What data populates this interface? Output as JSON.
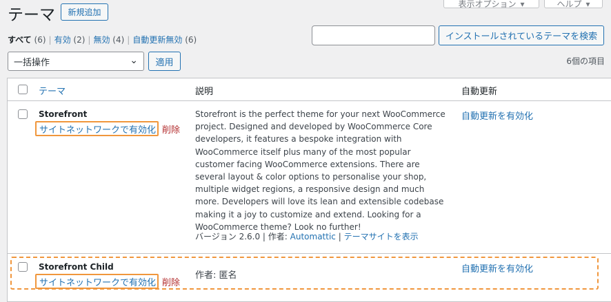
{
  "page": {
    "title": "テーマ",
    "add_new_label": "新規追加",
    "screen_options_label": "表示オプション",
    "help_label": "ヘルプ"
  },
  "views": [
    {
      "label": "すべて",
      "count": "(6)",
      "current": true
    },
    {
      "label": "有効",
      "count": "(2)"
    },
    {
      "label": "無効",
      "count": "(4)"
    },
    {
      "label": "自動更新無効",
      "count": "(6)"
    }
  ],
  "search": {
    "value": "",
    "button_label": "インストールされているテーマを検索"
  },
  "bulk": {
    "selected": "一括操作",
    "apply_label": "適用"
  },
  "items_count": "6個の項目",
  "table": {
    "columns": [
      "テーマ",
      "説明",
      "自動更新"
    ],
    "rows": [
      {
        "name": "Storefront",
        "network_enable": "サイトネットワークで有効化",
        "delete": "削除",
        "description": "Storefront is the perfect theme for your next WooCommerce project. Designed and developed by WooCommerce Core developers, it features a bespoke integration with WooCommerce itself plus many of the most popular customer facing WooCommerce extensions. There are several layout & color options to personalise your shop, multiple widget regions, a responsive design and much more. Developers will love its lean and extensible codebase making it a joy to customize and extend. Looking for a WooCommerce theme? Look no further!",
        "version": "バージョン 2.6.0",
        "author_label": "作者:",
        "author": "Automattic",
        "visit_site": "テーマサイトを表示",
        "auto_update": "自動更新を有効化"
      },
      {
        "name": "Storefront Child",
        "network_enable": "サイトネットワークで有効化",
        "delete": "削除",
        "author_info": "作者: 匿名",
        "auto_update": "自動更新を有効化"
      }
    ]
  },
  "colors": {
    "link": "#2271b1",
    "delete": "#b32d2e",
    "highlight": "#f0963c",
    "background": "#f0f0f1"
  }
}
